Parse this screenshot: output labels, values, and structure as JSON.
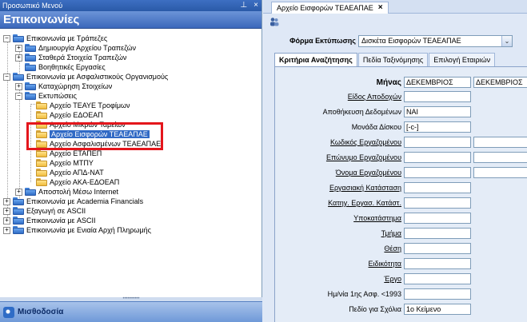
{
  "left_panel": {
    "window_title": "Προσωπικό Μενού",
    "header": "Επικοινωνίες",
    "footer_label": "Μισθοδοσία",
    "tree": [
      {
        "label": "Επικοινωνία με Τράπεζες",
        "expander": "−"
      },
      {
        "label": "Δημιουργία Αρχείου Τραπεζών",
        "expander": "+"
      },
      {
        "label": "Σταθερά Στοιχεία Τραπεζών",
        "expander": "+"
      },
      {
        "label": "Βοηθητικές Εργασίες",
        "expander": ""
      },
      {
        "label": "Επικοινωνία με Ασφαλιστικούς Οργανισμούς",
        "expander": "−"
      },
      {
        "label": "Καταχώρηση Στοιχείων",
        "expander": "+"
      },
      {
        "label": "Εκτυπώσεις",
        "expander": "−"
      },
      {
        "label": "Αρχείο ΤΕΑΥΕ Τροφίμων",
        "expander": ""
      },
      {
        "label": "Αρχείο ΕΔΟΕΑΠ",
        "expander": ""
      },
      {
        "label": "Αρχείο Μικρών Ταμείων",
        "expander": ""
      },
      {
        "label": "Αρχείο Εισφορών ΤΕΑΕΑΠΑΕ",
        "expander": "",
        "selected": true
      },
      {
        "label": "Αρχείο Ασφαλισμένων ΤΕΑΕΑΠΑΕ",
        "expander": ""
      },
      {
        "label": "Αρχείο ΕΤΑΠΕΠ",
        "expander": ""
      },
      {
        "label": "Αρχείο ΜΤΠΥ",
        "expander": ""
      },
      {
        "label": "Αρχείο ΑΠΔ-ΝΑΤ",
        "expander": ""
      },
      {
        "label": "Αρχείο ΑΚΑ-ΕΔΟΕΑΠ",
        "expander": ""
      },
      {
        "label": "Αποστολή Μέσω Internet",
        "expander": "+"
      },
      {
        "label": "Επικοινωνία με Academia Financials",
        "expander": "+"
      },
      {
        "label": "Εξαγωγή σε ASCII",
        "expander": "+"
      },
      {
        "label": "Επικοινωνία με ASCII",
        "expander": "+"
      },
      {
        "label": "Επικοινωνία με Ενιαία Αρχή Πληρωμής",
        "expander": "+"
      }
    ]
  },
  "right_panel": {
    "doc_tab": "Αρχείο Εισφορών ΤΕΑΕΑΠΑΕ",
    "doc_tab_close": "×",
    "form_label": "Φόρμα Εκτύπωσης",
    "form_value": "Δισκέτα Εισφορών ΤΕΑΕΑΠΑΕ",
    "sub_tabs": [
      "Κριτήρια Αναζήτησης",
      "Πεδία Ταξινόμησης",
      "Επιλογή Εταιριών"
    ],
    "fields": {
      "month": {
        "label": "Μήνας",
        "from": "ΔΕΚΕΜΒΡΙΟΣ",
        "to": "ΔΕΚΕΜΒΡΙΟΣ"
      },
      "payment_type": {
        "label": "Είδος Αποδοχών",
        "value": ""
      },
      "save_data": {
        "label": "Αποθήκευση Δεδομένων",
        "value": "ΝΑΙ"
      },
      "disk_unit": {
        "label": "Μονάδα Δίσκου",
        "value": "[-c-]"
      },
      "employee_code": {
        "label": "Κωδικός Εργαζομένου",
        "from": "",
        "to": ""
      },
      "employee_surname": {
        "label": "Επώνυμο Εργαζομένου",
        "from": "",
        "to": ""
      },
      "employee_name": {
        "label": "Όνομα Εργαζομένου",
        "from": "",
        "to": ""
      },
      "work_status": {
        "label": "Εργασιακή Κατάσταση",
        "value": ""
      },
      "employee_category": {
        "label": "Κατηγ. Εργασ. Κατάστ.",
        "value": ""
      },
      "branch": {
        "label": "Υποκατάστημα",
        "value": ""
      },
      "department": {
        "label": "Τμήμα",
        "value": ""
      },
      "position": {
        "label": "Θέση",
        "value": ""
      },
      "specialty": {
        "label": "Ειδικότητα",
        "value": ""
      },
      "project": {
        "label": "Έργο",
        "value": ""
      },
      "first_insurance_date": {
        "label": "Ημ/νία 1ης Ασφ. <1993",
        "value": ""
      },
      "comments_field": {
        "label": "Πεδίο για Σχόλια",
        "value": "1ο Κείμενο"
      }
    }
  },
  "colors": {
    "selection": "#316ac5",
    "highlight_box": "#e4161c",
    "panel_bg": "#dfe8f6"
  }
}
